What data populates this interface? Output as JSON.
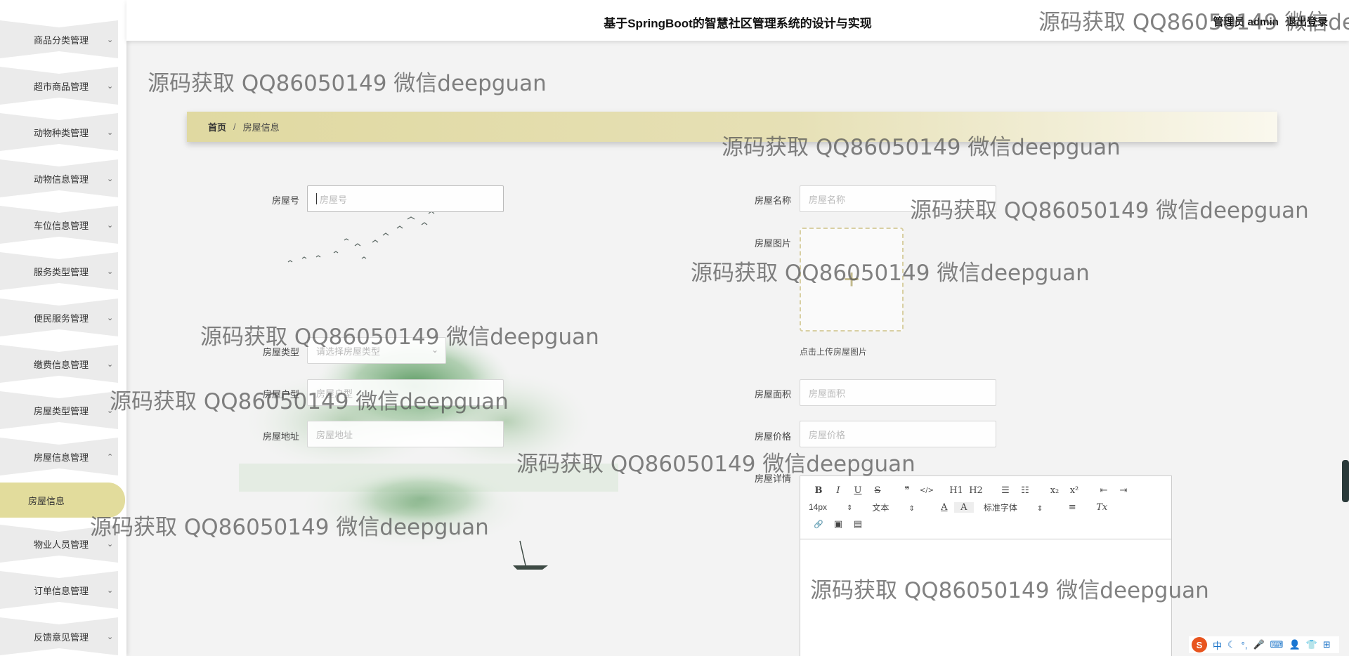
{
  "header": {
    "title": "基于SpringBoot的智慧社区管理系统的设计与实现",
    "user_label": "管理员 admin",
    "logout_label": "退出登录"
  },
  "sidebar": {
    "items": [
      {
        "label": "商品分类管理"
      },
      {
        "label": "超市商品管理"
      },
      {
        "label": "动物种类管理"
      },
      {
        "label": "动物信息管理"
      },
      {
        "label": "车位信息管理"
      },
      {
        "label": "服务类型管理"
      },
      {
        "label": "便民服务管理"
      },
      {
        "label": "缴费信息管理"
      },
      {
        "label": "房屋类型管理"
      },
      {
        "label": "房屋信息管理",
        "expanded": true
      },
      {
        "label": "物业人员管理"
      },
      {
        "label": "订单信息管理"
      },
      {
        "label": "反馈意见管理"
      }
    ],
    "active_sub": "房屋信息",
    "active_color": "#e2dc9c"
  },
  "breadcrumb": {
    "home": "首页",
    "separator": "/",
    "current": "房屋信息"
  },
  "form": {
    "house_no": {
      "label": "房屋号",
      "placeholder": "房屋号"
    },
    "house_name": {
      "label": "房屋名称",
      "placeholder": "房屋名称"
    },
    "house_image": {
      "label": "房屋图片",
      "hint": "点击上传房屋图片",
      "plus": "+"
    },
    "house_type": {
      "label": "房屋类型",
      "placeholder": "请选择房屋类型"
    },
    "house_layout": {
      "label": "房屋户型",
      "placeholder": "房屋户型"
    },
    "house_area": {
      "label": "房屋面积",
      "placeholder": "房屋面积"
    },
    "house_address": {
      "label": "房屋地址",
      "placeholder": "房屋地址"
    },
    "house_price": {
      "label": "房屋价格",
      "placeholder": "房屋价格"
    },
    "house_detail": {
      "label": "房屋详情"
    }
  },
  "editor": {
    "row1": [
      "B",
      "I",
      "U",
      "S",
      "❞",
      "</>",
      "H1",
      "H2",
      "☰",
      "☷",
      "x₂",
      "x²",
      "⇤",
      "⇥"
    ],
    "font_size": "14px",
    "block_type": "文本",
    "font_family": "标准字体",
    "row2_icons": [
      "A",
      "A",
      "≡",
      "Tx"
    ],
    "row3_icons": [
      "🔗",
      "▣",
      "▤"
    ]
  },
  "watermark": "源码获取 QQ86050149 微信deepguan",
  "ime": {
    "logo": "S",
    "mode": "中",
    "icons": [
      "☾",
      "°,",
      "🎤",
      "⌨",
      "👤",
      "👕",
      "⊞"
    ]
  },
  "colors": {
    "accent": "#e2dc9c",
    "breadcrumb_start": "#e0d9a1",
    "breadcrumb_end": "#faf8ee"
  }
}
